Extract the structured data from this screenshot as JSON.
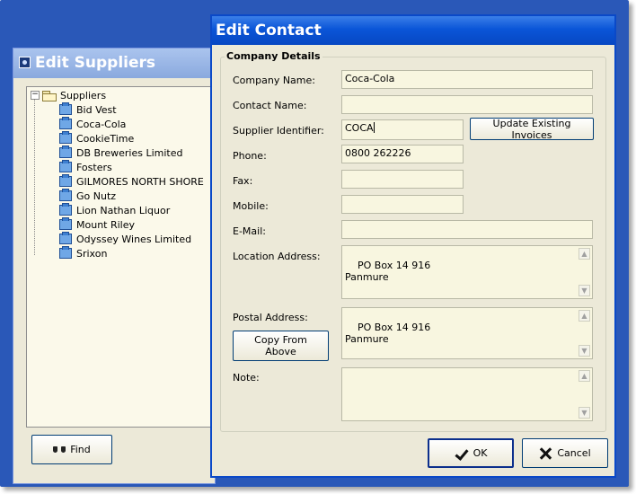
{
  "suppliers_window": {
    "title": "Edit Suppliers",
    "root_label": "Suppliers",
    "root_expander": "−",
    "items": [
      "Bid Vest",
      "Coca-Cola",
      "CookieTime",
      "DB Breweries Limited",
      "Fosters",
      "GILMORES NORTH SHORE",
      "Go Nutz",
      "Lion Nathan Liquor",
      "Mount Riley",
      "Odyssey Wines Limited",
      "Srixon"
    ],
    "find_label": "Find"
  },
  "edit_contact": {
    "title": "Edit Contact",
    "group_label": "Company Details",
    "labels": {
      "company_name": "Company Name:",
      "contact_name": "Contact Name:",
      "supplier_identifier": "Supplier Identifier:",
      "phone": "Phone:",
      "fax": "Fax:",
      "mobile": "Mobile:",
      "email": "E-Mail:",
      "location_address": "Location Address:",
      "postal_address": "Postal Address:",
      "note": "Note:"
    },
    "values": {
      "company_name": "Coca-Cola",
      "contact_name": "",
      "supplier_identifier": "COCA",
      "phone": "0800 262226",
      "fax": "",
      "mobile": "",
      "email": "",
      "location_address": "PO Box 14 916\nPanmure",
      "postal_address": "PO Box 14 916\nPanmure",
      "note": ""
    },
    "buttons": {
      "update_invoices": "Update Existing Invoices",
      "copy_from_above": "Copy From Above",
      "ok": "OK",
      "cancel": "Cancel"
    }
  }
}
